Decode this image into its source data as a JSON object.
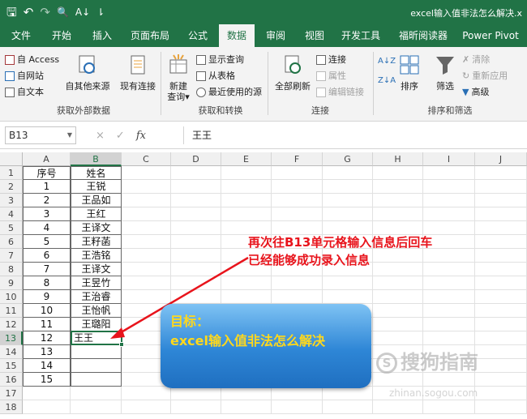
{
  "window": {
    "title": "excel输入值非法怎么解决.x"
  },
  "qat": {
    "save": "🖫",
    "undo": "↶",
    "redo": "↷",
    "preview": "🔍",
    "sort": "A↓",
    "more": "⇂"
  },
  "tabs": [
    "文件",
    "开始",
    "插入",
    "页面布局",
    "公式",
    "数据",
    "审阅",
    "视图",
    "开发工具",
    "福昕阅读器",
    "Power Pivot"
  ],
  "ribbon": {
    "get_external": {
      "access": "自 Access",
      "web": "自网站",
      "text": "自文本",
      "other": "自其他来源",
      "existing": "现有连接",
      "group": "获取外部数据"
    },
    "transform": {
      "new_query": "新建\n查询▾",
      "show_queries": "显示查询",
      "from_table": "从表格",
      "recent": "最近使用的源",
      "group": "获取和转换"
    },
    "connections": {
      "refresh_all": "全部刷新",
      "connections": "连接",
      "properties": "属性",
      "edit_links": "编辑链接",
      "group": "连接"
    },
    "sort_filter": {
      "sort_az": "A↓Z",
      "sort_za": "Z↓A",
      "sort": "排序",
      "filter": "筛选",
      "clear": "清除",
      "reapply": "重新应用",
      "advanced": "高级",
      "group": "排序和筛选"
    }
  },
  "formula_bar": {
    "name_box": "B13",
    "cancel": "×",
    "enter": "✓",
    "fx": "fx",
    "content": "王王"
  },
  "columns": [
    "A",
    "B",
    "C",
    "D",
    "E",
    "F",
    "G",
    "H",
    "I",
    "J"
  ],
  "rows": [
    "1",
    "2",
    "3",
    "4",
    "5",
    "6",
    "7",
    "8",
    "9",
    "10",
    "11",
    "12",
    "13",
    "14",
    "15",
    "16",
    "17",
    "18"
  ],
  "table": {
    "headers": [
      "序号",
      "姓名"
    ],
    "data": [
      [
        "1",
        "王锐"
      ],
      [
        "2",
        "王品如"
      ],
      [
        "3",
        "王红"
      ],
      [
        "4",
        "王译文"
      ],
      [
        "5",
        "王籽菡"
      ],
      [
        "6",
        "王浩铭"
      ],
      [
        "7",
        "王译文"
      ],
      [
        "8",
        "王昱竹"
      ],
      [
        "9",
        "王治睿"
      ],
      [
        "10",
        "王怡帆"
      ],
      [
        "11",
        "王璐阳"
      ],
      [
        "12",
        "王王"
      ],
      [
        "13",
        ""
      ],
      [
        "14",
        ""
      ],
      [
        "15",
        ""
      ]
    ]
  },
  "annotation": {
    "line1": "再次往B13单元格输入信息后回车",
    "line2": "已经能够成功录入信息"
  },
  "goal_box": {
    "line1": "目标：",
    "line2": "excel输入值非法怎么解决"
  },
  "watermark": {
    "main": "搜狗指南",
    "sub": "zhinan.sogou.com",
    "icon": "S"
  },
  "colors": {
    "excel_green": "#217346",
    "annotation_red": "#e8141c",
    "goal_text": "#ffd81c"
  }
}
